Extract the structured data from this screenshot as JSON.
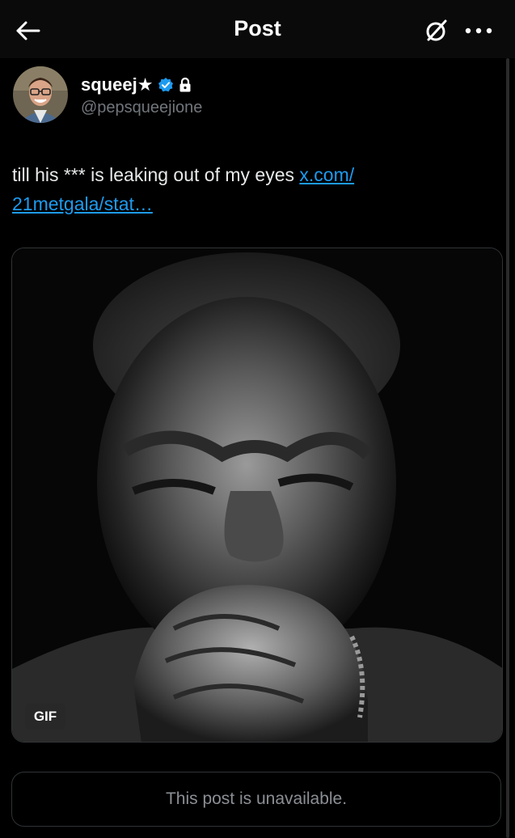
{
  "header": {
    "title": "Post",
    "back_icon": "arrow-left-icon",
    "grok_icon": "grok-icon",
    "more_icon": "more-horizontal-icon"
  },
  "post": {
    "author": {
      "display_name": "squeej★",
      "handle": "@pepsqueejione",
      "verified": true,
      "protected": true,
      "avatar_icon": "avatar-photo"
    },
    "text": "till his *** is leaking out of my eyes ",
    "link_text": "x.com/​21metgala/stat…",
    "media": {
      "type": "gif",
      "badge": "GIF",
      "description_icon": "gif-media"
    },
    "quote": {
      "status": "This post is unavailable."
    }
  },
  "colors": {
    "background": "#000000",
    "text": "#e7e9ea",
    "secondary": "#71767b",
    "link": "#1d9bf0",
    "verified": "#1d9bf0"
  }
}
